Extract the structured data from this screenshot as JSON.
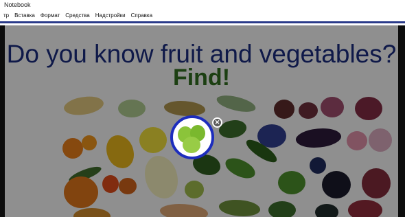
{
  "window": {
    "title": "Notebook"
  },
  "menu": {
    "items": [
      "тр",
      "Вставка",
      "Формат",
      "Средства",
      "Надстройки",
      "Справка"
    ]
  },
  "page": {
    "heading": "Do you know fruit and vegetables?",
    "subheading": "Find!"
  },
  "spotlight": {
    "close_glyph": "✕"
  },
  "colors": {
    "heading": "#1a2a7a",
    "subheading": "#2f6a1f",
    "spotlight_ring": "#1d2dbd",
    "menu_border": "#2a3a8a"
  }
}
